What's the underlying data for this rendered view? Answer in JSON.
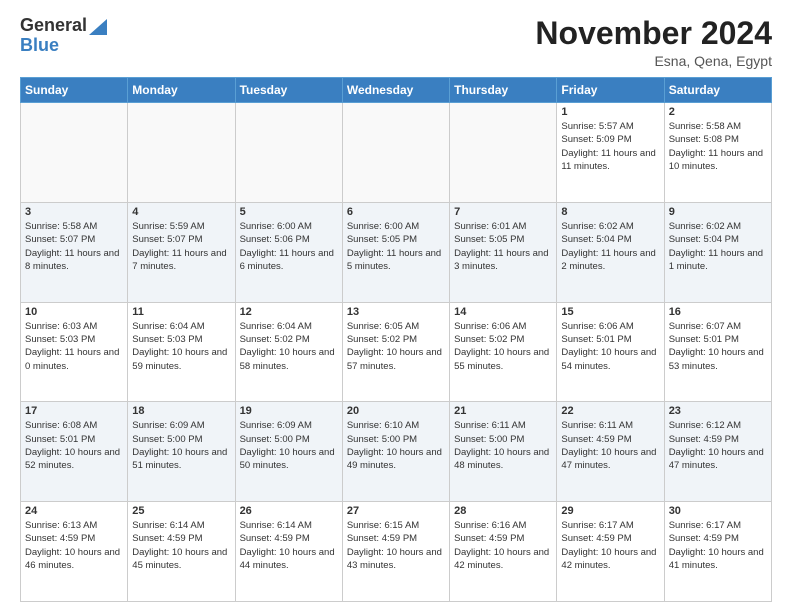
{
  "logo": {
    "general": "General",
    "blue": "Blue"
  },
  "title": "November 2024",
  "location": "Esna, Qena, Egypt",
  "weekdays": [
    "Sunday",
    "Monday",
    "Tuesday",
    "Wednesday",
    "Thursday",
    "Friday",
    "Saturday"
  ],
  "weeks": [
    [
      {
        "day": "",
        "info": ""
      },
      {
        "day": "",
        "info": ""
      },
      {
        "day": "",
        "info": ""
      },
      {
        "day": "",
        "info": ""
      },
      {
        "day": "",
        "info": ""
      },
      {
        "day": "1",
        "info": "Sunrise: 5:57 AM\nSunset: 5:09 PM\nDaylight: 11 hours\nand 11 minutes."
      },
      {
        "day": "2",
        "info": "Sunrise: 5:58 AM\nSunset: 5:08 PM\nDaylight: 11 hours\nand 10 minutes."
      }
    ],
    [
      {
        "day": "3",
        "info": "Sunrise: 5:58 AM\nSunset: 5:07 PM\nDaylight: 11 hours\nand 8 minutes."
      },
      {
        "day": "4",
        "info": "Sunrise: 5:59 AM\nSunset: 5:07 PM\nDaylight: 11 hours\nand 7 minutes."
      },
      {
        "day": "5",
        "info": "Sunrise: 6:00 AM\nSunset: 5:06 PM\nDaylight: 11 hours\nand 6 minutes."
      },
      {
        "day": "6",
        "info": "Sunrise: 6:00 AM\nSunset: 5:05 PM\nDaylight: 11 hours\nand 5 minutes."
      },
      {
        "day": "7",
        "info": "Sunrise: 6:01 AM\nSunset: 5:05 PM\nDaylight: 11 hours\nand 3 minutes."
      },
      {
        "day": "8",
        "info": "Sunrise: 6:02 AM\nSunset: 5:04 PM\nDaylight: 11 hours\nand 2 minutes."
      },
      {
        "day": "9",
        "info": "Sunrise: 6:02 AM\nSunset: 5:04 PM\nDaylight: 11 hours\nand 1 minute."
      }
    ],
    [
      {
        "day": "10",
        "info": "Sunrise: 6:03 AM\nSunset: 5:03 PM\nDaylight: 11 hours\nand 0 minutes."
      },
      {
        "day": "11",
        "info": "Sunrise: 6:04 AM\nSunset: 5:03 PM\nDaylight: 10 hours\nand 59 minutes."
      },
      {
        "day": "12",
        "info": "Sunrise: 6:04 AM\nSunset: 5:02 PM\nDaylight: 10 hours\nand 58 minutes."
      },
      {
        "day": "13",
        "info": "Sunrise: 6:05 AM\nSunset: 5:02 PM\nDaylight: 10 hours\nand 57 minutes."
      },
      {
        "day": "14",
        "info": "Sunrise: 6:06 AM\nSunset: 5:02 PM\nDaylight: 10 hours\nand 55 minutes."
      },
      {
        "day": "15",
        "info": "Sunrise: 6:06 AM\nSunset: 5:01 PM\nDaylight: 10 hours\nand 54 minutes."
      },
      {
        "day": "16",
        "info": "Sunrise: 6:07 AM\nSunset: 5:01 PM\nDaylight: 10 hours\nand 53 minutes."
      }
    ],
    [
      {
        "day": "17",
        "info": "Sunrise: 6:08 AM\nSunset: 5:01 PM\nDaylight: 10 hours\nand 52 minutes."
      },
      {
        "day": "18",
        "info": "Sunrise: 6:09 AM\nSunset: 5:00 PM\nDaylight: 10 hours\nand 51 minutes."
      },
      {
        "day": "19",
        "info": "Sunrise: 6:09 AM\nSunset: 5:00 PM\nDaylight: 10 hours\nand 50 minutes."
      },
      {
        "day": "20",
        "info": "Sunrise: 6:10 AM\nSunset: 5:00 PM\nDaylight: 10 hours\nand 49 minutes."
      },
      {
        "day": "21",
        "info": "Sunrise: 6:11 AM\nSunset: 5:00 PM\nDaylight: 10 hours\nand 48 minutes."
      },
      {
        "day": "22",
        "info": "Sunrise: 6:11 AM\nSunset: 4:59 PM\nDaylight: 10 hours\nand 47 minutes."
      },
      {
        "day": "23",
        "info": "Sunrise: 6:12 AM\nSunset: 4:59 PM\nDaylight: 10 hours\nand 47 minutes."
      }
    ],
    [
      {
        "day": "24",
        "info": "Sunrise: 6:13 AM\nSunset: 4:59 PM\nDaylight: 10 hours\nand 46 minutes."
      },
      {
        "day": "25",
        "info": "Sunrise: 6:14 AM\nSunset: 4:59 PM\nDaylight: 10 hours\nand 45 minutes."
      },
      {
        "day": "26",
        "info": "Sunrise: 6:14 AM\nSunset: 4:59 PM\nDaylight: 10 hours\nand 44 minutes."
      },
      {
        "day": "27",
        "info": "Sunrise: 6:15 AM\nSunset: 4:59 PM\nDaylight: 10 hours\nand 43 minutes."
      },
      {
        "day": "28",
        "info": "Sunrise: 6:16 AM\nSunset: 4:59 PM\nDaylight: 10 hours\nand 42 minutes."
      },
      {
        "day": "29",
        "info": "Sunrise: 6:17 AM\nSunset: 4:59 PM\nDaylight: 10 hours\nand 42 minutes."
      },
      {
        "day": "30",
        "info": "Sunrise: 6:17 AM\nSunset: 4:59 PM\nDaylight: 10 hours\nand 41 minutes."
      }
    ]
  ]
}
